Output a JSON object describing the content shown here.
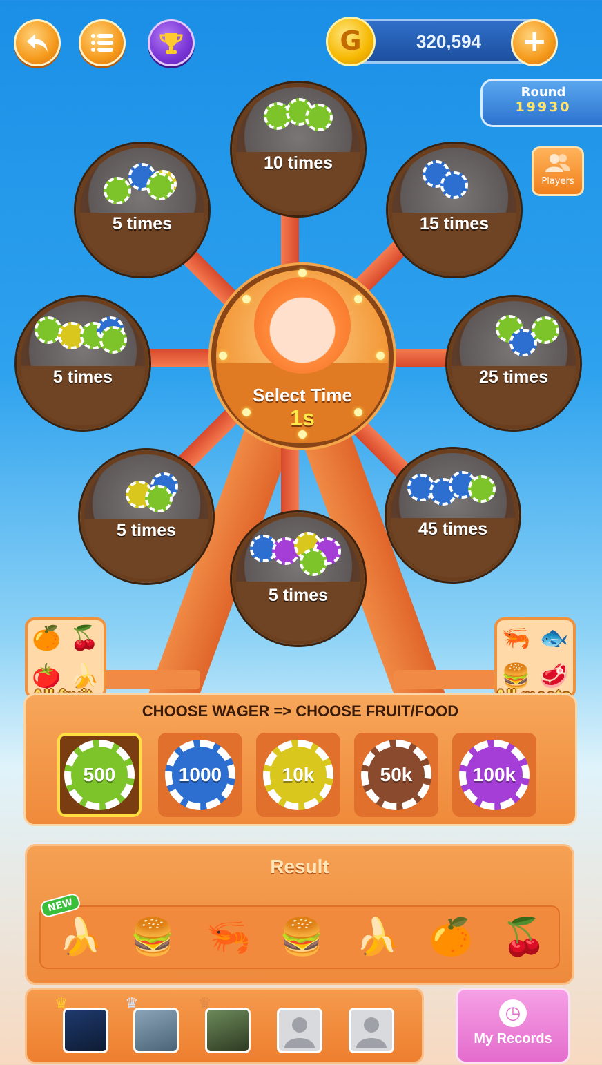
{
  "header": {
    "back_icon": "back-arrow-icon",
    "menu_icon": "list-menu-icon",
    "trophy_icon": "trophy-icon",
    "coin_symbol": "G",
    "coin_balance": "320,594",
    "plus_label": "+",
    "round_label": "Round",
    "round_number": "19930",
    "players_label": "Players"
  },
  "wheel": {
    "center_title": "Select Time",
    "center_time": "1s",
    "seats": [
      {
        "label": "10 times"
      },
      {
        "label": "15 times"
      },
      {
        "label": "25 times"
      },
      {
        "label": "45 times"
      },
      {
        "label": "5 times"
      },
      {
        "label": "5 times"
      },
      {
        "label": "5 times"
      },
      {
        "label": "5 times"
      }
    ]
  },
  "categories": {
    "left_label": "All fruit",
    "right_label": "All meats"
  },
  "wager": {
    "heading": "CHOOSE WAGER => CHOOSE FRUIT/FOOD",
    "chips": [
      {
        "label": "500",
        "color": "#7cc42a",
        "selected": true
      },
      {
        "label": "1000",
        "color": "#2c6fd1",
        "selected": false
      },
      {
        "label": "10k",
        "color": "#d9c71e",
        "selected": false
      },
      {
        "label": "50k",
        "color": "#8a4a2e",
        "selected": false
      },
      {
        "label": "100k",
        "color": "#a53ed6",
        "selected": false
      }
    ]
  },
  "result": {
    "title": "Result",
    "new_badge": "NEW",
    "items": [
      "banana",
      "burger",
      "shrimp",
      "burger",
      "banana",
      "orange",
      "cherry"
    ]
  },
  "bottom": {
    "records_label": "My Records"
  },
  "colors": {
    "accent_orange": "#f08a3a",
    "wheel_spoke": "#e05a34",
    "selected_border": "#ffe040"
  }
}
